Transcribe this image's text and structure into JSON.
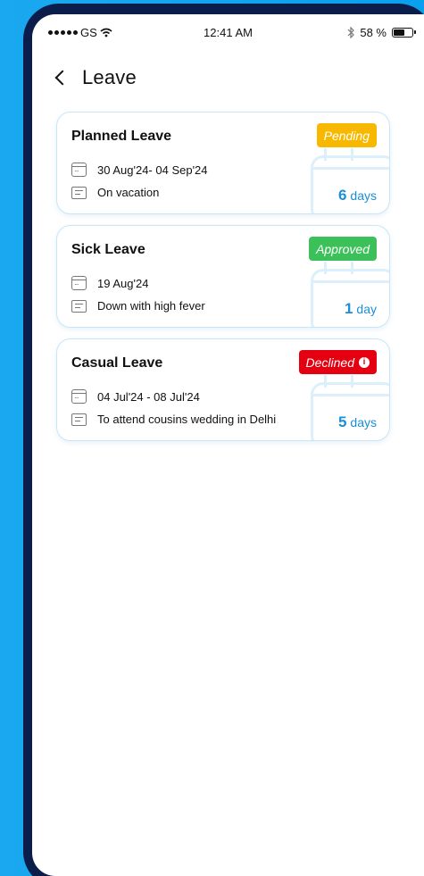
{
  "status_bar": {
    "carrier": "GS",
    "time": "12:41 AM",
    "battery": "58 %"
  },
  "header": {
    "title": "Leave"
  },
  "leaves": [
    {
      "title": "Planned Leave",
      "status": "Pending",
      "status_color": "#f9b800",
      "dates": "30 Aug'24- 04 Sep'24",
      "reason": "On vacation",
      "days_num": "6",
      "days_unit": "days"
    },
    {
      "title": "Sick Leave",
      "status": "Approved",
      "status_color": "#3cc15a",
      "dates": "19 Aug'24",
      "reason": "Down with high fever",
      "days_num": "1",
      "days_unit": "day"
    },
    {
      "title": "Casual Leave",
      "status": "Declined",
      "status_color": "#e40010",
      "dates": "04 Jul'24 - 08 Jul'24",
      "reason": "To attend cousins wedding in Delhi",
      "days_num": "5",
      "days_unit": "days"
    }
  ],
  "icons": {
    "back": "chevron-left-icon",
    "date": "calendar-icon",
    "reason": "note-icon",
    "info": "info-icon",
    "bluetooth": "bluetooth-icon",
    "wifi": "wifi-icon"
  }
}
